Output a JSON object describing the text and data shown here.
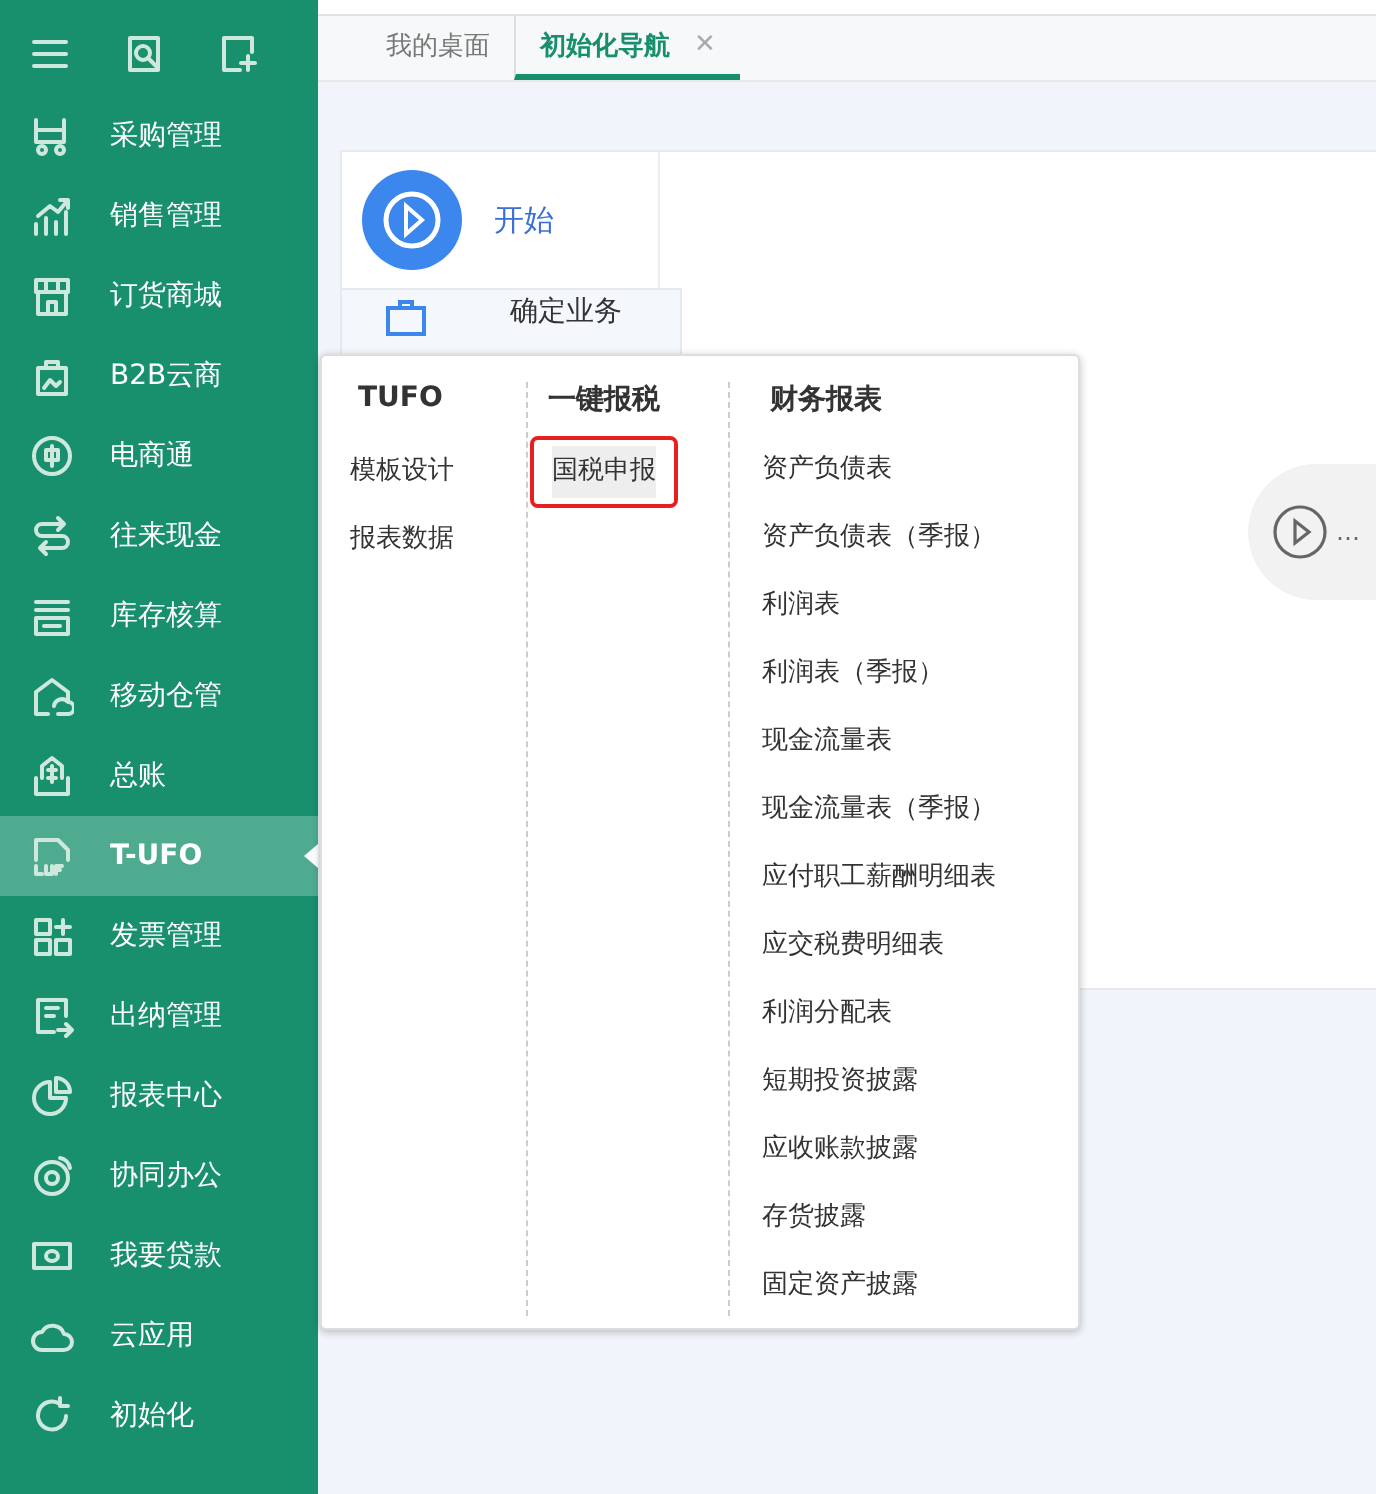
{
  "sidebar": {
    "items": [
      {
        "label": "采购管理",
        "selected": false
      },
      {
        "label": "销售管理",
        "selected": false
      },
      {
        "label": "订货商城",
        "selected": false
      },
      {
        "label": "B2B云商",
        "selected": false
      },
      {
        "label": "电商通",
        "selected": false
      },
      {
        "label": "往来现金",
        "selected": false
      },
      {
        "label": "库存核算",
        "selected": false
      },
      {
        "label": "移动仓管",
        "selected": false
      },
      {
        "label": "总账",
        "selected": false
      },
      {
        "label": "T-UFO",
        "selected": true
      },
      {
        "label": "发票管理",
        "selected": false
      },
      {
        "label": "出纳管理",
        "selected": false
      },
      {
        "label": "报表中心",
        "selected": false
      },
      {
        "label": "协同办公",
        "selected": false
      },
      {
        "label": "我要贷款",
        "selected": false
      },
      {
        "label": "云应用",
        "selected": false
      },
      {
        "label": "初始化",
        "selected": false
      }
    ]
  },
  "tabs": [
    {
      "label": "我的桌面",
      "selected": false
    },
    {
      "label": "初始化导航",
      "selected": true,
      "close": "✕"
    }
  ],
  "steps": [
    {
      "label": "开始",
      "kind": "current"
    },
    {
      "label": "确定业务",
      "kind": "pending"
    }
  ],
  "next_step": {
    "label": "…"
  },
  "popup": {
    "columns": [
      {
        "heading": "TUFO",
        "items": [
          {
            "label": "模板设计",
            "selected": false,
            "annotated": false
          },
          {
            "label": "报表数据",
            "selected": false,
            "annotated": false
          }
        ]
      },
      {
        "heading": "一键报税",
        "items": [
          {
            "label": "国税申报",
            "selected": true,
            "annotated": true
          }
        ]
      },
      {
        "heading": "财务报表",
        "items": [
          {
            "label": "资产负债表",
            "selected": false,
            "annotated": false
          },
          {
            "label": "资产负债表（季报）",
            "selected": false,
            "annotated": false
          },
          {
            "label": "利润表",
            "selected": false,
            "annotated": false
          },
          {
            "label": "利润表（季报）",
            "selected": false,
            "annotated": false
          },
          {
            "label": "现金流量表",
            "selected": false,
            "annotated": false
          },
          {
            "label": "现金流量表（季报）",
            "selected": false,
            "annotated": false
          },
          {
            "label": "应付职工薪酬明细表",
            "selected": false,
            "annotated": false
          },
          {
            "label": "应交税费明细表",
            "selected": false,
            "annotated": false
          },
          {
            "label": "利润分配表",
            "selected": false,
            "annotated": false
          },
          {
            "label": "短期投资披露",
            "selected": false,
            "annotated": false
          },
          {
            "label": "应收账款披露",
            "selected": false,
            "annotated": false
          },
          {
            "label": "存货披露",
            "selected": false,
            "annotated": false
          },
          {
            "label": "固定资产披露",
            "selected": false,
            "annotated": false
          }
        ]
      }
    ]
  }
}
